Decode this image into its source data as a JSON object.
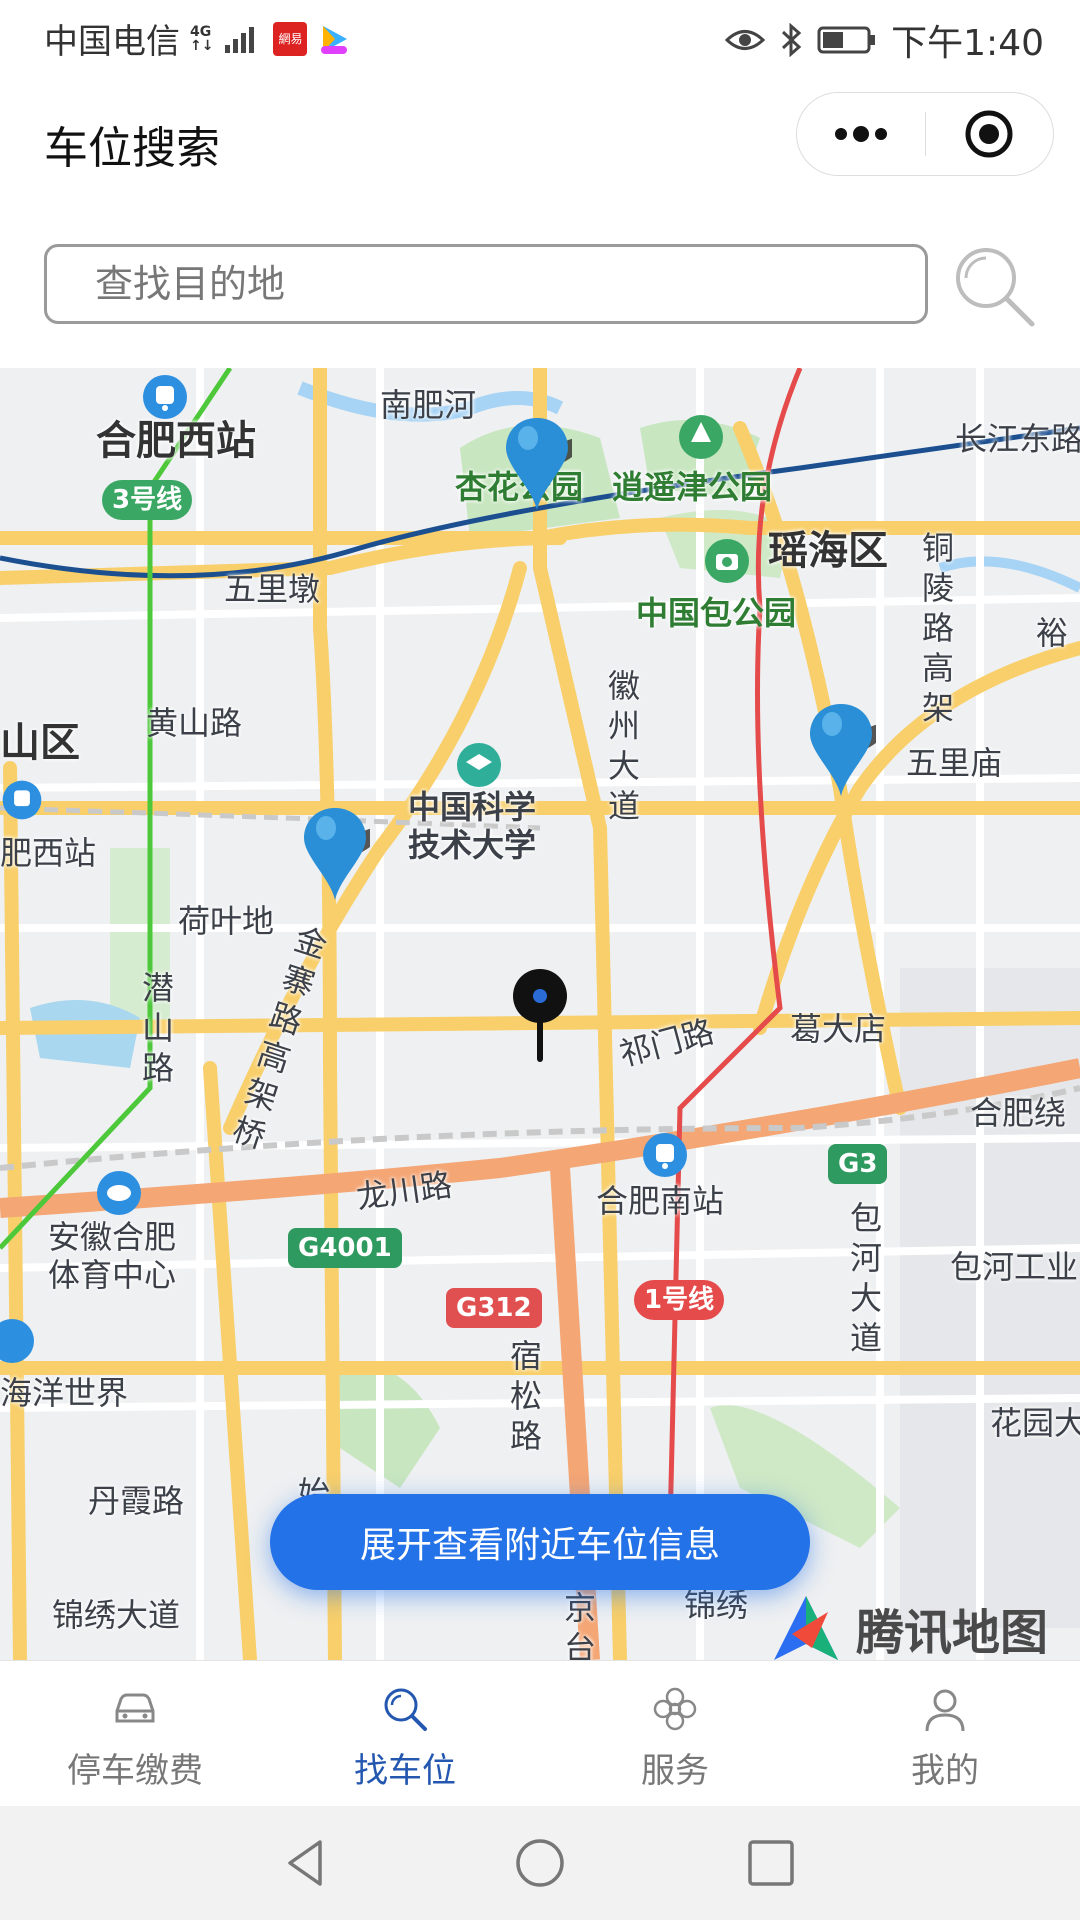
{
  "status": {
    "carrier": "中国电信",
    "net_top": "4G",
    "net_bottom": "↑↓",
    "app_badge": "網易",
    "time": "下午1:40"
  },
  "header": {
    "title": "车位搜索"
  },
  "search": {
    "placeholder": "查找目的地"
  },
  "map": {
    "labels": {
      "hefei_west_station": "合肥西站",
      "nanfei_river": "南肥河",
      "xinghua_park": "杏花公园",
      "xiaoyaojin_park": "逍遥津公园",
      "changjiang_east": "长江东路",
      "yaohai_district": "瑶海区",
      "tongling_road": "铜陵路高架",
      "wulidun": "五里墩",
      "baogong_park": "中国包公园",
      "yu": "裕",
      "huangshan_road": "黄山路",
      "huizhou_avenue": "徽州大道",
      "wulimiao": "五里庙",
      "shan_district": "山区",
      "ustc": "中国科学技术大学",
      "west_station_short": "肥西站",
      "heyedi": "荷叶地",
      "jinzhai_road": "金寨路高架桥",
      "qianshan_road": "潜山路",
      "qimen_road": "祁门路",
      "gedadian": "葛大店",
      "hefei_ring": "合肥绕",
      "longchuan_road": "龙川路",
      "hefei_south_station": "合肥南站",
      "baohe_avenue": "包河大道",
      "anhui_sports": "安徽合肥体育中心",
      "baohe_industrial": "包河工业",
      "ocean_world": "海洋世界",
      "susong_road": "宿松路",
      "huayuan": "花园大",
      "danxia_road": "丹霞路",
      "jinxiu_avenue": "锦绣大道",
      "jinxiu_short": "锦绣",
      "jing": "京台",
      "shi": "始"
    },
    "badges": {
      "line3": "3号线",
      "g4001": "G4001",
      "g312": "G312",
      "g3": "G3",
      "line1": "1号线"
    },
    "expand_button": "展开查看附近车位信息",
    "logo_text": "腾讯地图"
  },
  "tabs": [
    {
      "label": "停车缴费",
      "icon": "car-icon"
    },
    {
      "label": "找车位",
      "icon": "search-icon"
    },
    {
      "label": "服务",
      "icon": "flower-icon"
    },
    {
      "label": "我的",
      "icon": "user-icon"
    }
  ],
  "colors": {
    "accent": "#2472e8",
    "tab_active": "#2457b0",
    "pin_blue": "#2a8fd6"
  }
}
